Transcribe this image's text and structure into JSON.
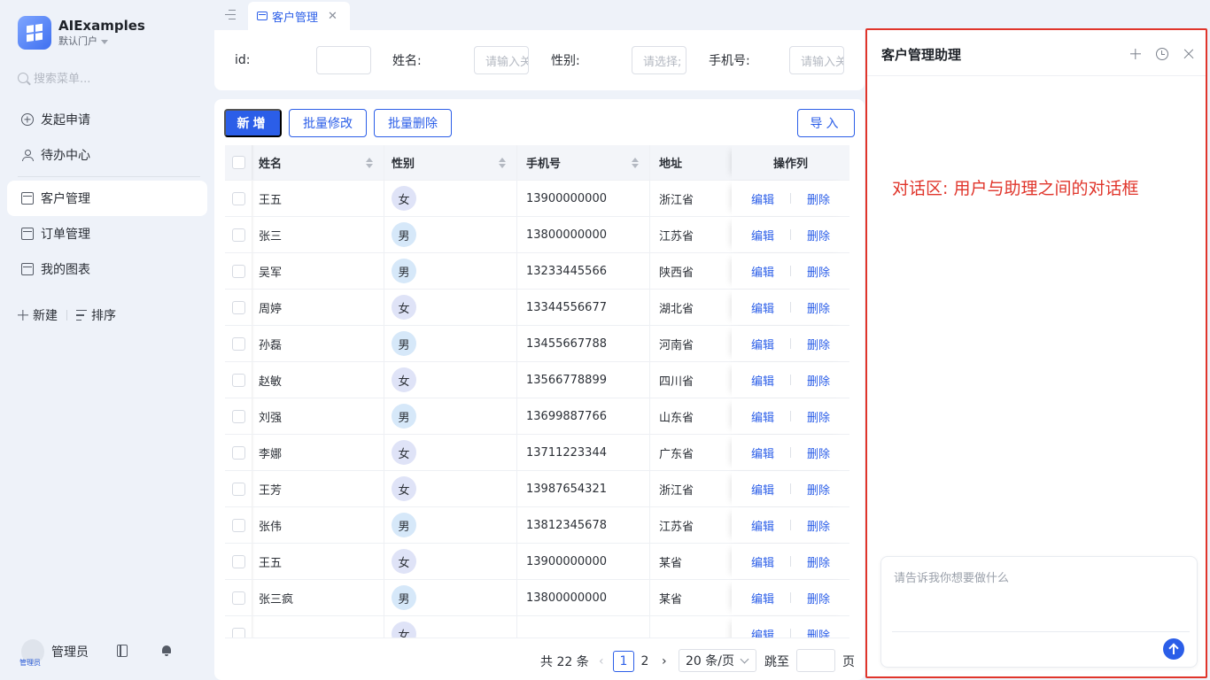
{
  "app": {
    "title": "AIExamples",
    "portal": "默认门户"
  },
  "sidebar": {
    "search_placeholder": "搜索菜单...",
    "items": [
      {
        "label": "发起申请",
        "icon": "plus-circle-icon"
      },
      {
        "label": "待办中心",
        "icon": "person-icon"
      },
      {
        "label": "客户管理",
        "icon": "card-icon",
        "active": true
      },
      {
        "label": "订单管理",
        "icon": "card-icon"
      },
      {
        "label": "我的图表",
        "icon": "card-icon"
      }
    ],
    "new_label": "新建",
    "sort_label": "排序",
    "user_name": "管理员",
    "avatar_caption": "管理员"
  },
  "tabs": [
    {
      "label": "客户管理",
      "active": true
    }
  ],
  "filters": {
    "id_label": "id:",
    "name_label": "姓名:",
    "name_placeholder": "请输入关",
    "gender_label": "性别:",
    "gender_placeholder": "请选择;",
    "phone_label": "手机号:",
    "phone_placeholder": "请输入关"
  },
  "toolbar": {
    "add": "新增",
    "batch_edit": "批量修改",
    "batch_delete": "批量删除",
    "import": "导入"
  },
  "table": {
    "columns": {
      "name": "姓名",
      "gender": "性别",
      "phone": "手机号",
      "address": "地址",
      "ops": "操作列"
    },
    "edit_label": "编辑",
    "delete_label": "删除",
    "rows": [
      {
        "name": "王五",
        "gender": "女",
        "phone": "13900000000",
        "address": "浙江省"
      },
      {
        "name": "张三",
        "gender": "男",
        "phone": "13800000000",
        "address": "江苏省"
      },
      {
        "name": "吴军",
        "gender": "男",
        "phone": "13233445566",
        "address": "陕西省"
      },
      {
        "name": "周婷",
        "gender": "女",
        "phone": "13344556677",
        "address": "湖北省"
      },
      {
        "name": "孙磊",
        "gender": "男",
        "phone": "13455667788",
        "address": "河南省"
      },
      {
        "name": "赵敏",
        "gender": "女",
        "phone": "13566778899",
        "address": "四川省"
      },
      {
        "name": "刘强",
        "gender": "男",
        "phone": "13699887766",
        "address": "山东省"
      },
      {
        "name": "李娜",
        "gender": "女",
        "phone": "13711223344",
        "address": "广东省"
      },
      {
        "name": "王芳",
        "gender": "女",
        "phone": "13987654321",
        "address": "浙江省"
      },
      {
        "name": "张伟",
        "gender": "男",
        "phone": "13812345678",
        "address": "江苏省"
      },
      {
        "name": "王五",
        "gender": "女",
        "phone": "13900000000",
        "address": "某省"
      },
      {
        "name": "张三疯",
        "gender": "男",
        "phone": "13800000000",
        "address": "某省"
      },
      {
        "name": "",
        "gender": "女",
        "phone": "",
        "address": ""
      }
    ]
  },
  "pagination": {
    "total_text": "共 22 条",
    "pages": [
      "1",
      "2"
    ],
    "current": "1",
    "page_size": "20 条/页",
    "jump_label": "跳至",
    "page_suffix": "页"
  },
  "assistant": {
    "title": "客户管理助理",
    "annotation": "对话区: 用户与助理之间的对话框",
    "input_placeholder": "请告诉我你想要做什么"
  },
  "colors": {
    "primary": "#2b5ee8",
    "annotation_red": "#e0352b"
  }
}
